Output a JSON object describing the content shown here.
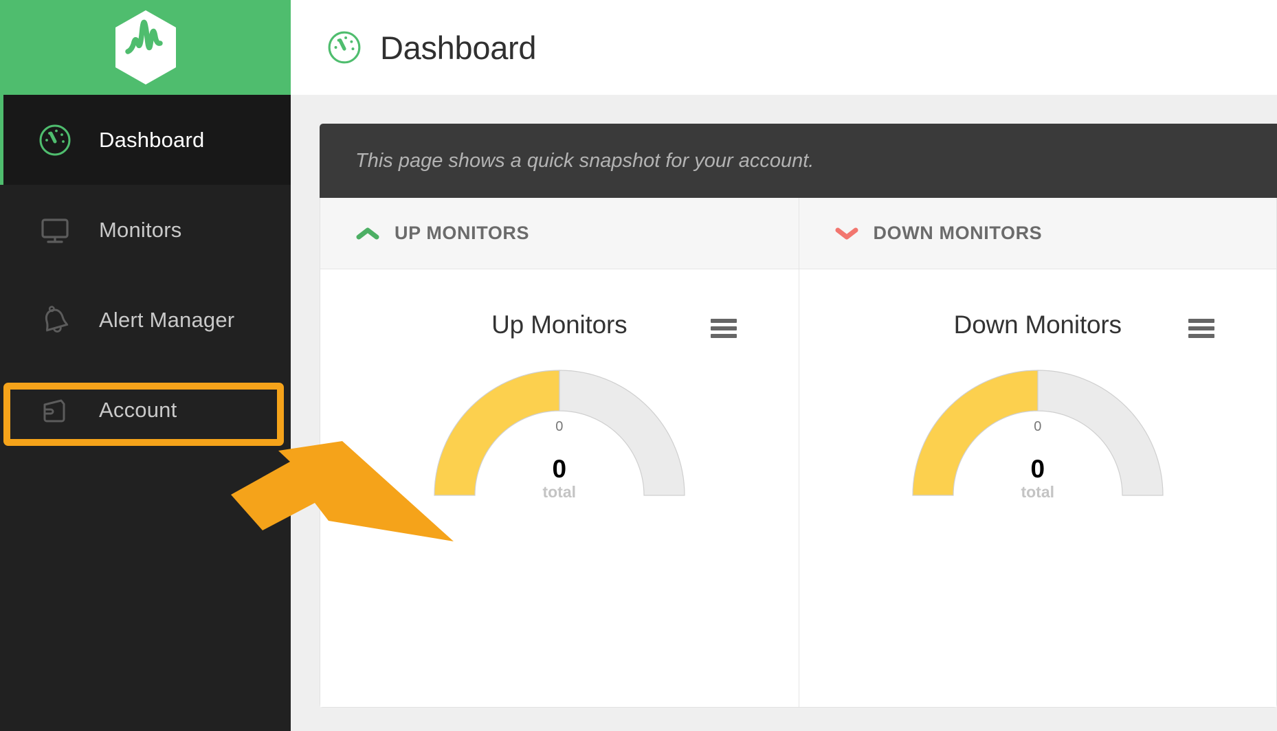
{
  "app": {
    "logo_icon": "pulse-hexagon-logo",
    "brand_color": "#4fbd6e",
    "sidebar_bg": "#212121",
    "accent_orange": "#f5a31a"
  },
  "sidebar": {
    "items": [
      {
        "label": "Dashboard",
        "icon": "gauge-icon",
        "active": true
      },
      {
        "label": "Monitors",
        "icon": "monitor-screen-icon",
        "active": false
      },
      {
        "label": "Alert Manager",
        "icon": "bell-icon",
        "active": false
      },
      {
        "label": "Account",
        "icon": "wallet-icon",
        "active": false
      }
    ]
  },
  "header": {
    "icon": "gauge-icon",
    "title": "Dashboard"
  },
  "banner": {
    "text": "This page shows a quick snapshot for your account."
  },
  "cards": [
    {
      "head_icon": "chevron-up-icon",
      "head_icon_color": "#4caf64",
      "head_label": "UP MONITORS",
      "chart_title": "Up Monitors",
      "menu_icon": "hamburger-menu-icon",
      "tick_label": "0",
      "value": "0",
      "value_sub": "total"
    },
    {
      "head_icon": "chevron-down-icon",
      "head_icon_color": "#f2766f",
      "head_label": "DOWN MONITORS",
      "chart_title": "Down Monitors",
      "menu_icon": "hamburger-menu-icon",
      "tick_label": "0",
      "value": "0",
      "value_sub": "total"
    }
  ],
  "annotation": {
    "target": "Account",
    "shape": "rectangle-with-arrow",
    "color": "#f5a31a"
  },
  "chart_data": [
    {
      "type": "pie",
      "title": "Up Monitors",
      "subtype": "half-donut-gauge",
      "labels": [
        "filled",
        "remaining"
      ],
      "values": [
        50,
        50
      ],
      "colors": [
        "#fcd04e",
        "#ebebeb"
      ],
      "center_value": 0,
      "center_label": "total",
      "tick_labels": [
        "0"
      ],
      "legend": "none",
      "grid": false
    },
    {
      "type": "pie",
      "title": "Down Monitors",
      "subtype": "half-donut-gauge",
      "labels": [
        "filled",
        "remaining"
      ],
      "values": [
        50,
        50
      ],
      "colors": [
        "#fcd04e",
        "#ebebeb"
      ],
      "center_value": 0,
      "center_label": "total",
      "tick_labels": [
        "0"
      ],
      "legend": "none",
      "grid": false
    }
  ]
}
